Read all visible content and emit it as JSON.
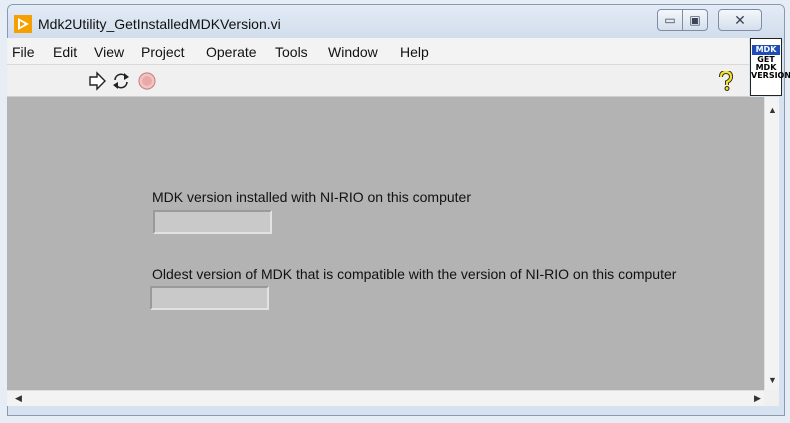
{
  "window": {
    "title": "Mdk2Utility_GetInstalledMDKVersion.vi",
    "controls": {
      "minimize": "▭",
      "maximize": "▣",
      "close": "✕"
    }
  },
  "menubar": {
    "items": [
      {
        "label": "File"
      },
      {
        "label": "Edit"
      },
      {
        "label": "View"
      },
      {
        "label": "Project"
      },
      {
        "label": "Operate"
      },
      {
        "label": "Tools"
      },
      {
        "label": "Window"
      },
      {
        "label": "Help"
      }
    ]
  },
  "toolbar": {
    "tools": [
      "run-arrow-icon",
      "run-continuously-icon",
      "abort-icon"
    ],
    "help_icon": "help-icon"
  },
  "vi_icon": {
    "line1": "MDK",
    "line2": "GET",
    "line3": "MDK",
    "line4": "VERSION"
  },
  "front_panel": {
    "installed": {
      "label": "MDK version installed with NI-RIO on this computer",
      "value": ""
    },
    "oldest": {
      "label": "Oldest version of MDK that is compatible with the version of NI-RIO on this computer",
      "value": ""
    }
  },
  "colors": {
    "panel_bg": "#b3b3b3",
    "indicator_bg": "#c9c9c9",
    "title_icon": "#f5a000",
    "vi_icon_band": "#1e4db7"
  }
}
